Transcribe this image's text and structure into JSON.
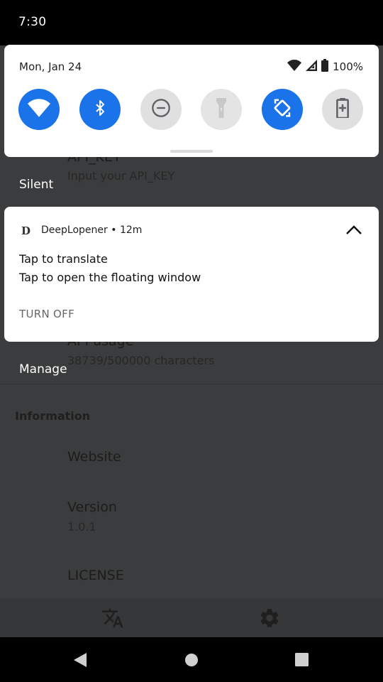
{
  "status_bar": {
    "time": "7:30"
  },
  "quick_settings": {
    "date": "Mon, Jan 24",
    "battery_percent": "100%",
    "tiles": [
      {
        "icon": "wifi-icon",
        "state": "on"
      },
      {
        "icon": "bluetooth-icon",
        "state": "on"
      },
      {
        "icon": "do-not-disturb-icon",
        "state": "off"
      },
      {
        "icon": "flashlight-icon",
        "state": "unavailable"
      },
      {
        "icon": "auto-rotate-icon",
        "state": "on"
      },
      {
        "icon": "battery-saver-icon",
        "state": "off"
      }
    ],
    "accent_color": "#1a73e8"
  },
  "shade": {
    "silent_label": "Silent",
    "manage_label": "Manage"
  },
  "notification": {
    "app_icon_letter": "D",
    "app_name": "DeepLopener",
    "separator": "•",
    "time": "12m",
    "title": "Tap to translate",
    "text": "Tap to open the floating window",
    "action_label": "TURN OFF"
  },
  "background_app": {
    "api_key_title": "API_KEY",
    "api_key_hint": "Input your API_KEY",
    "api_usage_title": "API usage",
    "api_usage_value": "38739/500000 characters",
    "information_header": "Information",
    "website_label": "Website",
    "version_label": "Version",
    "version_value": "1.0.1",
    "license_label": "LICENSE"
  }
}
